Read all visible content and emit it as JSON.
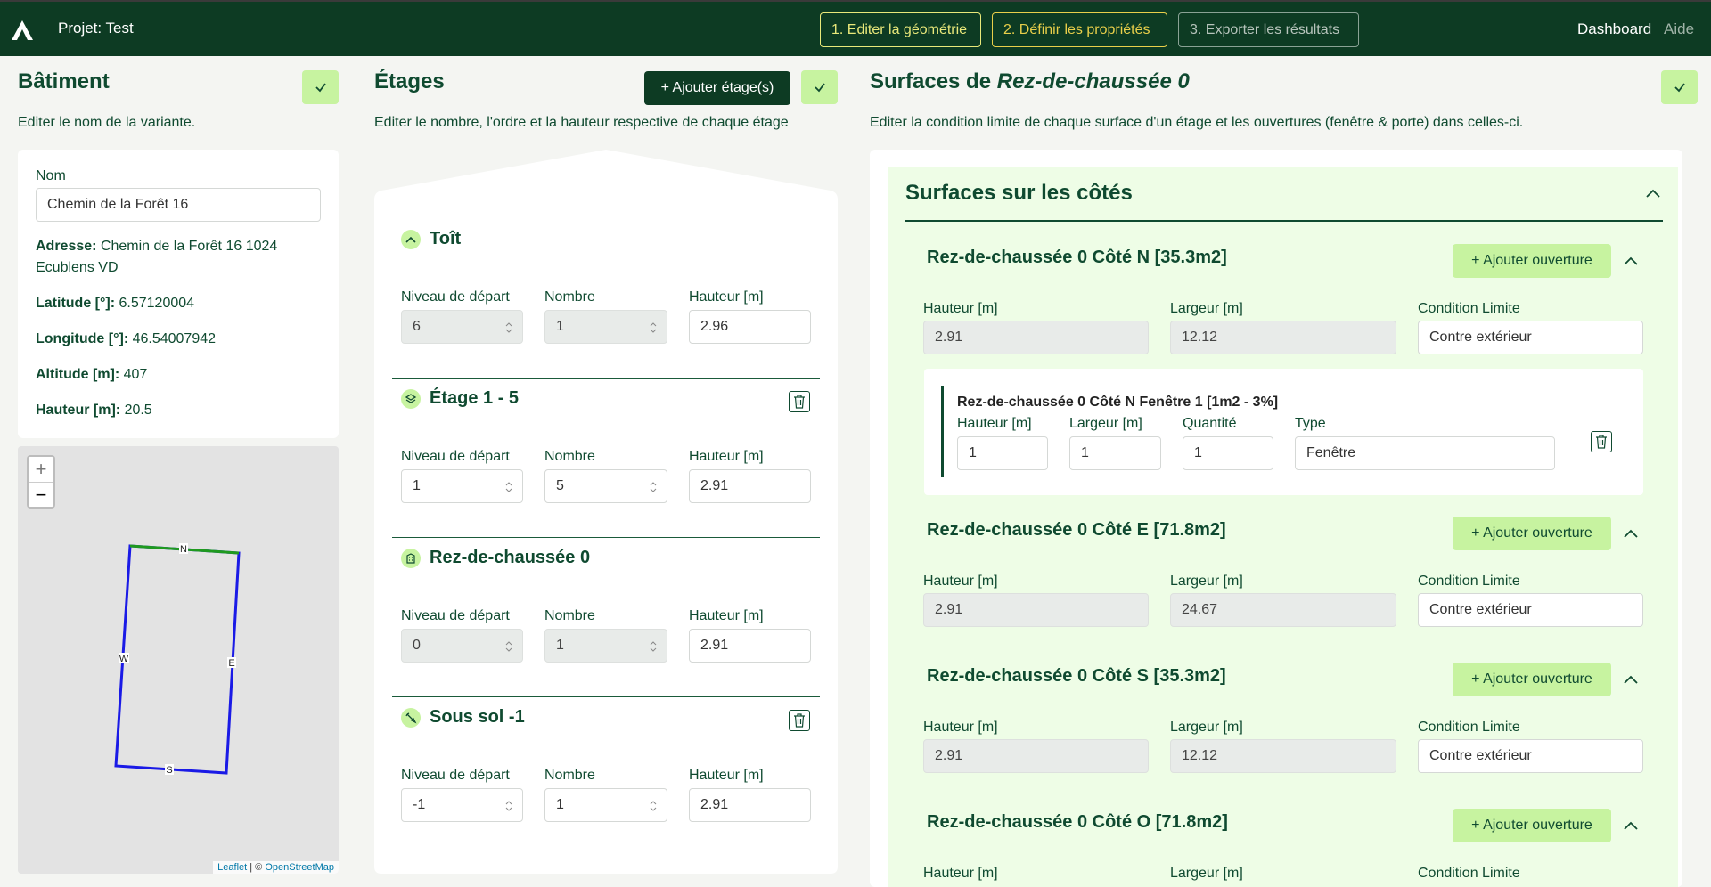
{
  "header": {
    "project": "Projet: Test",
    "steps": [
      "1. Editer la géométrie",
      "2. Définir les propriétés",
      "3. Exporter les résultats"
    ],
    "nav": [
      "Dashboard",
      "Aide"
    ]
  },
  "building": {
    "title": "Bâtiment",
    "desc": "Editer le nom de la variante.",
    "name_label": "Nom",
    "name_value": "Chemin de la Forêt 16",
    "address_label": "Adresse:",
    "address": "Chemin de la Forêt 16 1024 Ecublens VD",
    "lat_label": "Latitude [°]:",
    "lat": "6.57120004",
    "lon_label": "Longitude [°]:",
    "lon": "46.54007942",
    "alt_label": "Altitude [m]:",
    "alt": "407",
    "height_label": "Hauteur [m]:",
    "height": "20.5"
  },
  "map": {
    "zoom_in": "+",
    "zoom_out": "−",
    "compass": [
      "N",
      "E",
      "S",
      "W"
    ],
    "attrib_leaflet": "Leaflet",
    "attrib_sep": " | © ",
    "attrib_osm": "OpenStreetMap"
  },
  "floors": {
    "title": "Étages",
    "add": "+ Ajouter étage(s)",
    "desc": "Editer le nombre, l'ordre et la hauteur respective de chaque étage",
    "labels": {
      "start": "Niveau de départ",
      "count": "Nombre",
      "height": "Hauteur [m]"
    },
    "items": [
      {
        "name": "Toît",
        "start": "6",
        "count": "1",
        "height": "2.96"
      },
      {
        "name": "Étage 1 - 5",
        "start": "1",
        "count": "5",
        "height": "2.91"
      },
      {
        "name": "Rez-de-chaussée 0",
        "start": "0",
        "count": "1",
        "height": "2.91"
      },
      {
        "name": "Sous sol -1",
        "start": "-1",
        "count": "1",
        "height": "2.91"
      }
    ]
  },
  "surfaces": {
    "title_prefix": "Surfaces de ",
    "title_floor": "Rez-de-chaussée 0",
    "desc": "Editer la condition limite de chaque surface d'un étage et les ouvertures (fenêtre & porte) dans celles-ci.",
    "group_title": "Surfaces sur les côtés",
    "add_opening": "+ Ajouter ouverture",
    "labels": {
      "height": "Hauteur [m]",
      "width": "Largeur [m]",
      "cond": "Condition Limite",
      "qty": "Quantité",
      "type": "Type"
    },
    "sides": [
      {
        "name": "Rez-de-chaussée 0 Côté N [35.3m2]",
        "height": "2.91",
        "width": "12.12",
        "cond": "Contre extérieur"
      },
      {
        "name": "Rez-de-chaussée 0 Côté E [71.8m2]",
        "height": "2.91",
        "width": "24.67",
        "cond": "Contre extérieur"
      },
      {
        "name": "Rez-de-chaussée 0 Côté S [35.3m2]",
        "height": "2.91",
        "width": "12.12",
        "cond": "Contre extérieur"
      },
      {
        "name": "Rez-de-chaussée 0 Côté O [71.8m2]"
      }
    ],
    "opening": {
      "title": "Rez-de-chaussée 0 Côté N Fenêtre 1 [1m2 - 3%]",
      "height": "1",
      "width": "1",
      "qty": "1",
      "type": "Fenêtre"
    }
  }
}
